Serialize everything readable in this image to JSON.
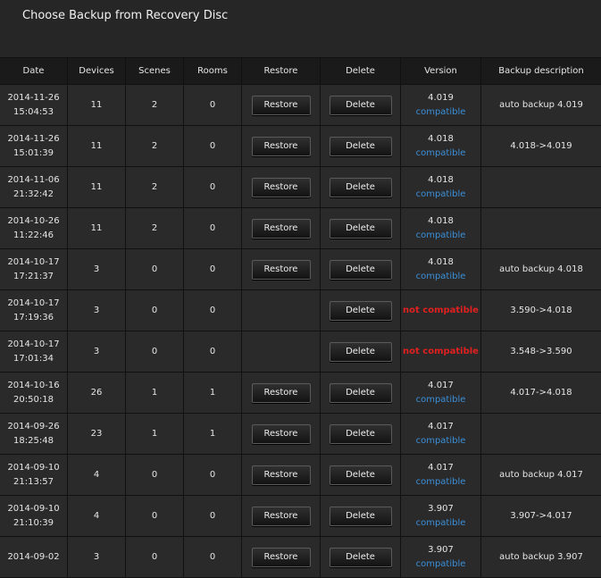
{
  "page": {
    "title": "Choose Backup from Recovery Disc"
  },
  "columns": {
    "date": "Date",
    "devices": "Devices",
    "scenes": "Scenes",
    "rooms": "Rooms",
    "restore": "Restore",
    "delete": "Delete",
    "version": "Version",
    "description": "Backup description"
  },
  "labels": {
    "restore": "Restore",
    "delete": "Delete"
  },
  "rows": [
    {
      "date": "2014-11-26",
      "time": "15:04:53",
      "devices": "11",
      "scenes": "2",
      "rooms": "0",
      "restore": true,
      "version": "4.019",
      "status": "compatible",
      "desc": "auto backup 4.019"
    },
    {
      "date": "2014-11-26",
      "time": "15:01:39",
      "devices": "11",
      "scenes": "2",
      "rooms": "0",
      "restore": true,
      "version": "4.018",
      "status": "compatible",
      "desc": "4.018->4.019"
    },
    {
      "date": "2014-11-06",
      "time": "21:32:42",
      "devices": "11",
      "scenes": "2",
      "rooms": "0",
      "restore": true,
      "version": "4.018",
      "status": "compatible",
      "desc": ""
    },
    {
      "date": "2014-10-26",
      "time": "11:22:46",
      "devices": "11",
      "scenes": "2",
      "rooms": "0",
      "restore": true,
      "version": "4.018",
      "status": "compatible",
      "desc": ""
    },
    {
      "date": "2014-10-17",
      "time": "17:21:37",
      "devices": "3",
      "scenes": "0",
      "rooms": "0",
      "restore": true,
      "version": "4.018",
      "status": "compatible",
      "desc": "auto backup 4.018"
    },
    {
      "date": "2014-10-17",
      "time": "17:19:36",
      "devices": "3",
      "scenes": "0",
      "rooms": "0",
      "restore": false,
      "version": "",
      "status": "not compatible",
      "desc": "3.590->4.018"
    },
    {
      "date": "2014-10-17",
      "time": "17:01:34",
      "devices": "3",
      "scenes": "0",
      "rooms": "0",
      "restore": false,
      "version": "",
      "status": "not compatible",
      "desc": "3.548->3.590"
    },
    {
      "date": "2014-10-16",
      "time": "20:50:18",
      "devices": "26",
      "scenes": "1",
      "rooms": "1",
      "restore": true,
      "version": "4.017",
      "status": "compatible",
      "desc": "4.017->4.018"
    },
    {
      "date": "2014-09-26",
      "time": "18:25:48",
      "devices": "23",
      "scenes": "1",
      "rooms": "1",
      "restore": true,
      "version": "4.017",
      "status": "compatible",
      "desc": ""
    },
    {
      "date": "2014-09-10",
      "time": "21:13:57",
      "devices": "4",
      "scenes": "0",
      "rooms": "0",
      "restore": true,
      "version": "4.017",
      "status": "compatible",
      "desc": "auto backup 4.017"
    },
    {
      "date": "2014-09-10",
      "time": "21:10:39",
      "devices": "4",
      "scenes": "0",
      "rooms": "0",
      "restore": true,
      "version": "3.907",
      "status": "compatible",
      "desc": "3.907->4.017"
    },
    {
      "date": "2014-09-02",
      "time": "",
      "devices": "3",
      "scenes": "0",
      "rooms": "0",
      "restore": true,
      "version": "3.907",
      "status": "compatible",
      "desc": "auto backup 3.907"
    }
  ]
}
